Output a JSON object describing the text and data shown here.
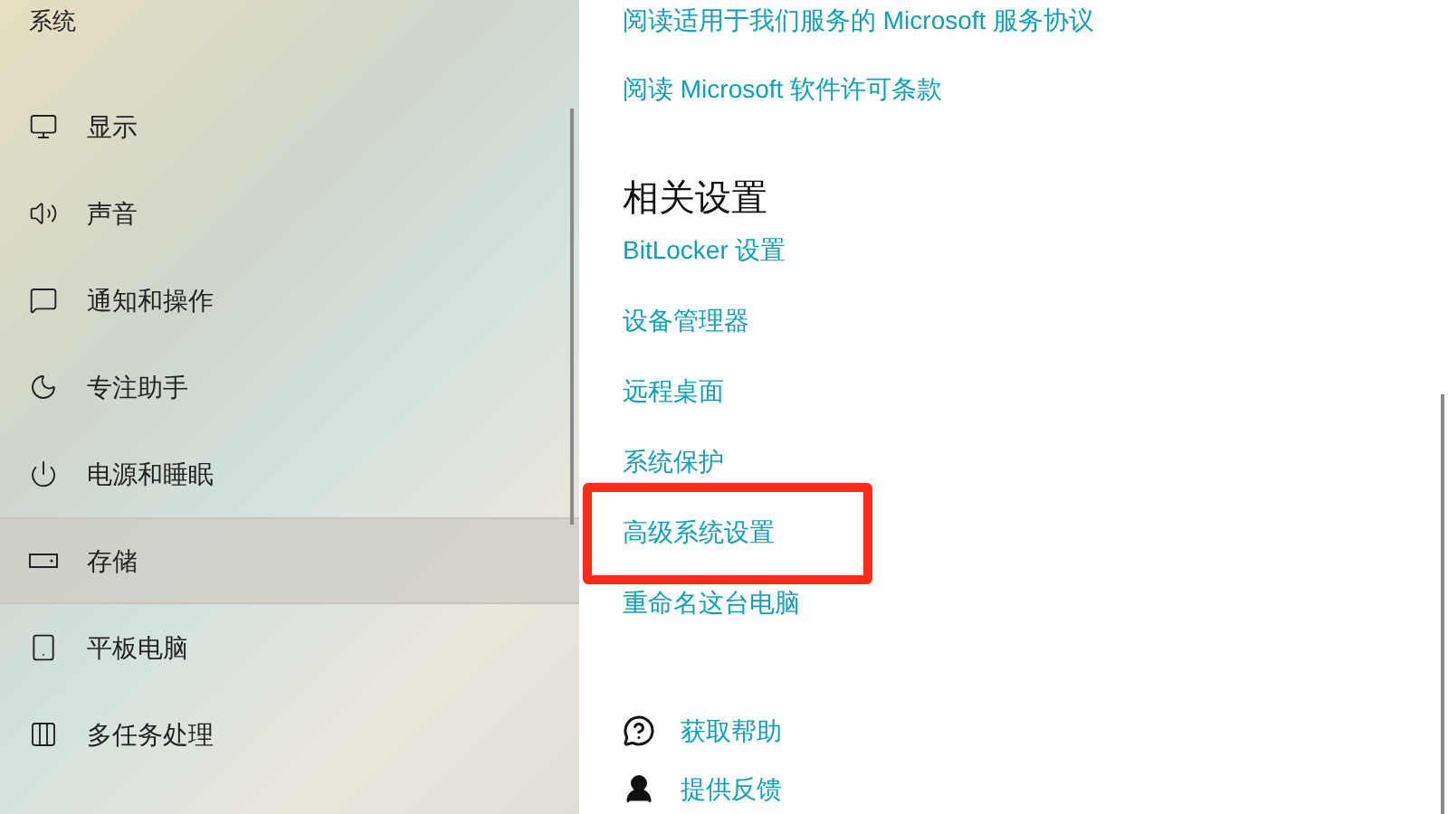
{
  "sidebar": {
    "title": "系统",
    "items": [
      {
        "label": "显示",
        "kind": "display",
        "selected": false
      },
      {
        "label": "声音",
        "kind": "sound",
        "selected": false
      },
      {
        "label": "通知和操作",
        "kind": "notify",
        "selected": false
      },
      {
        "label": "专注助手",
        "kind": "moon",
        "selected": false
      },
      {
        "label": "电源和睡眠",
        "kind": "power",
        "selected": false
      },
      {
        "label": "存储",
        "kind": "storage",
        "selected": true
      },
      {
        "label": "平板电脑",
        "kind": "tablet",
        "selected": false
      },
      {
        "label": "多任务处理",
        "kind": "multitask",
        "selected": false
      }
    ]
  },
  "top_links": [
    "阅读适用于我们服务的 Microsoft 服务协议",
    "阅读 Microsoft 软件许可条款"
  ],
  "related": {
    "heading": "相关设置",
    "links": [
      {
        "label": "BitLocker 设置",
        "highlighted": false
      },
      {
        "label": "设备管理器",
        "highlighted": false
      },
      {
        "label": "远程桌面",
        "highlighted": false
      },
      {
        "label": "系统保护",
        "highlighted": false
      },
      {
        "label": "高级系统设置",
        "highlighted": true
      },
      {
        "label": "重命名这台电脑",
        "highlighted": false
      }
    ]
  },
  "help": [
    {
      "label": "获取帮助",
      "kind": "help"
    },
    {
      "label": "提供反馈",
      "kind": "feedback"
    }
  ]
}
